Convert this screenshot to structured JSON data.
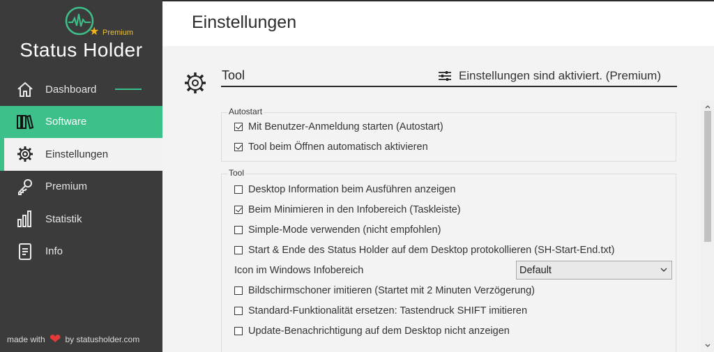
{
  "app": {
    "brand": "Status Holder",
    "premium_badge": "Premium"
  },
  "sidebar": {
    "items": [
      {
        "label": "Dashboard",
        "icon": "home-icon"
      },
      {
        "label": "Software",
        "icon": "books-icon"
      },
      {
        "label": "Einstellungen",
        "icon": "gear-icon"
      },
      {
        "label": "Premium",
        "icon": "key-icon"
      },
      {
        "label": "Statistik",
        "icon": "bar-chart-icon"
      },
      {
        "label": "Info",
        "icon": "document-icon"
      }
    ],
    "footer": {
      "made_with": "made with",
      "by": "by statusholder.com"
    }
  },
  "header": {
    "title": "Einstellungen"
  },
  "section": {
    "title": "Tool",
    "status": "Einstellungen sind aktiviert. (Premium)"
  },
  "groups": {
    "autostart": {
      "legend": "Autostart",
      "items": [
        {
          "label": "Mit Benutzer-Anmeldung starten (Autostart)",
          "checked": true
        },
        {
          "label": "Tool beim Öffnen automatisch aktivieren",
          "checked": true
        }
      ]
    },
    "tool": {
      "legend": "Tool",
      "items": [
        {
          "label": "Desktop Information beim Ausführen anzeigen",
          "checked": false
        },
        {
          "label": "Beim Minimieren in den Infobereich (Taskleiste)",
          "checked": true
        },
        {
          "label": "Simple-Mode verwenden (nicht empfohlen)",
          "checked": false
        },
        {
          "label": "Start & Ende des Status Holder auf dem Desktop protokollieren (SH-Start-End.txt)",
          "checked": false
        },
        {
          "label": "Bildschirmschoner imitieren (Startet mit 2 Minuten Verzögerung)",
          "checked": false
        },
        {
          "label": "Standard-Funktionalität ersetzen: Tastendruck SHIFT imitieren",
          "checked": false
        },
        {
          "label": "Update-Benachrichtigung auf dem Desktop nicht anzeigen",
          "checked": false
        }
      ],
      "icon_label": "Icon im Windows Infobereich",
      "icon_select_value": "Default"
    }
  },
  "colors": {
    "accent": "#3ec08a",
    "sidebar": "#3b3b3b",
    "heart": "#e33b3b",
    "star": "#f1b51b"
  }
}
